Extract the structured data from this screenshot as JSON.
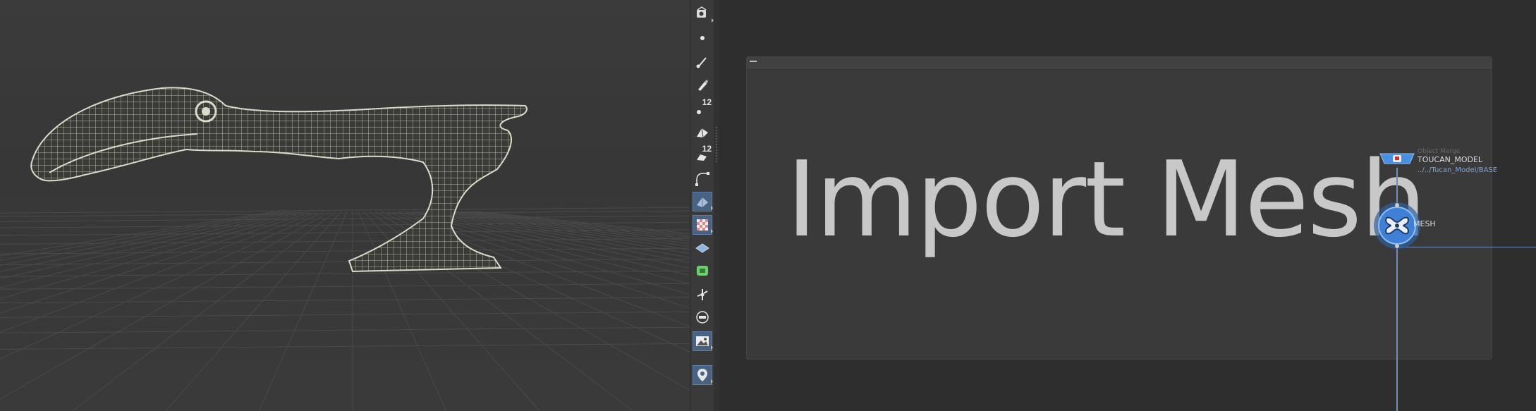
{
  "toolbar": {
    "tools": [
      {
        "id": "view",
        "icon": "view-camera-icon"
      },
      {
        "id": "points",
        "icon": "point-icon"
      },
      {
        "id": "brush",
        "icon": "brush-icon"
      },
      {
        "id": "pen",
        "icon": "pen-icon"
      },
      {
        "id": "point-numbers",
        "icon": "point-number-icon",
        "label": "12"
      },
      {
        "id": "prim",
        "icon": "primitive-icon"
      },
      {
        "id": "prim-numbers",
        "icon": "primitive-number-icon",
        "label": "12"
      },
      {
        "id": "snap",
        "icon": "snap-curve-icon"
      },
      {
        "id": "shaded",
        "icon": "shaded-mode-icon",
        "active": true
      },
      {
        "id": "texture",
        "icon": "checker-texture-icon",
        "active": true
      },
      {
        "id": "template",
        "icon": "template-icon"
      },
      {
        "id": "uv",
        "icon": "uv-icon"
      },
      {
        "id": "light",
        "icon": "light-icon"
      },
      {
        "id": "display",
        "icon": "display-options-icon"
      },
      {
        "id": "background",
        "icon": "background-image-icon",
        "active": true
      },
      {
        "id": "location",
        "icon": "location-pin-icon",
        "active": true
      }
    ]
  },
  "network": {
    "box_title": "Import Mesh",
    "nodes": {
      "object_merge": {
        "type": "Object Merge",
        "name": "TOUCAN_MODEL",
        "path": "../../Tucan_Model/BASE",
        "color": "#4a90e2"
      },
      "mesh": {
        "name": "MESH",
        "color": "#3f7fd6"
      }
    }
  },
  "colors": {
    "wireframe": "#dadccb",
    "accent": "#5d7ea8",
    "wire": "#6f8fb8"
  }
}
